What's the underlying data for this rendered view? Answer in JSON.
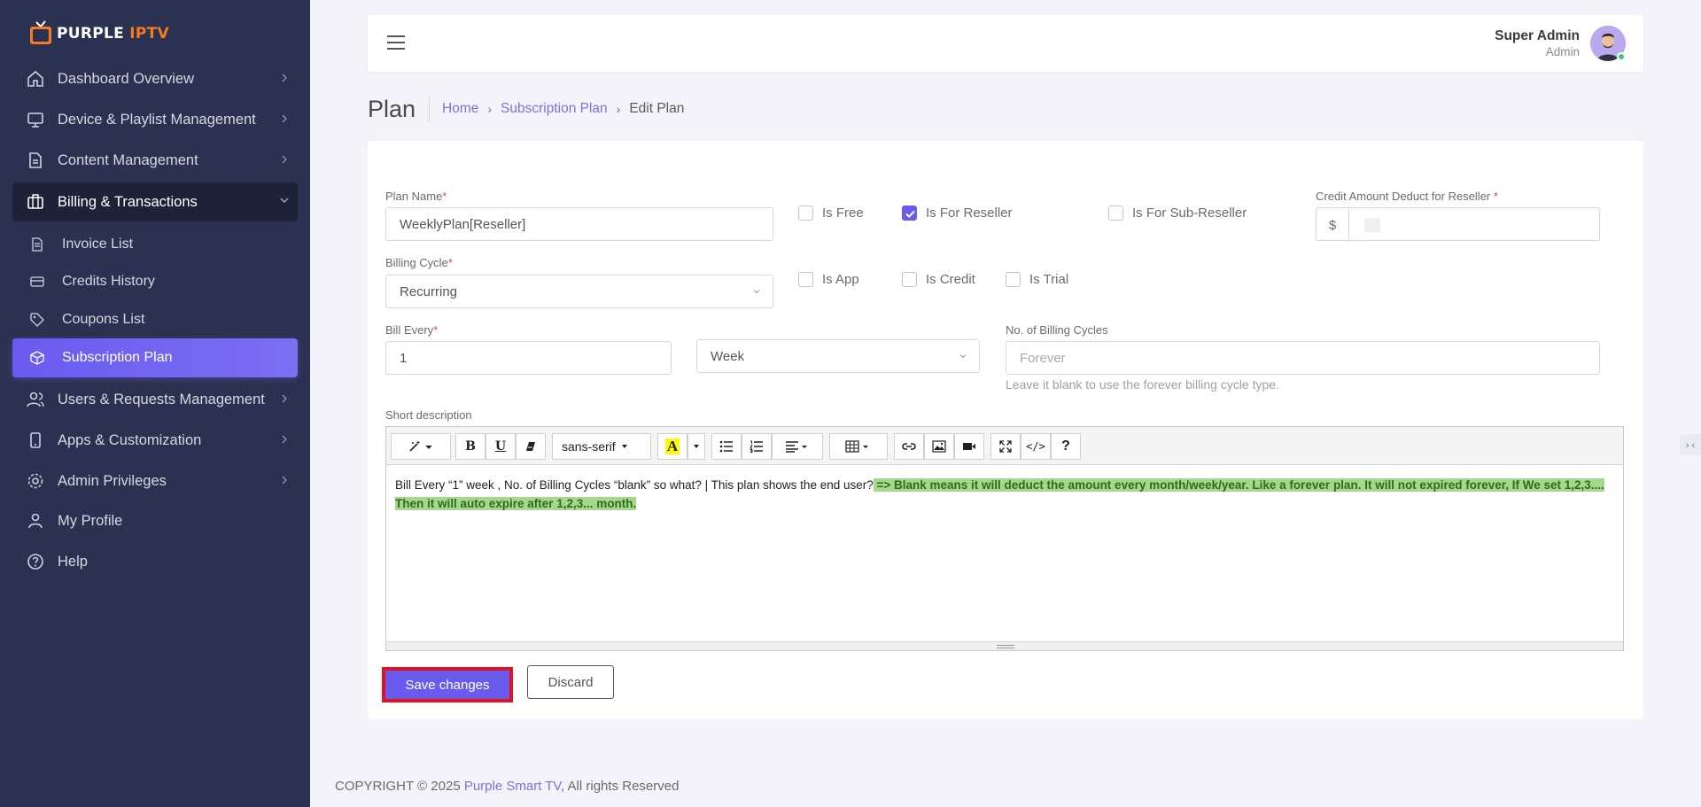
{
  "brand": {
    "word1": "PURPLE",
    "word2": "IPTV",
    "mark_text": "TV"
  },
  "sidebar": {
    "items": [
      {
        "label": "Dashboard Overview",
        "icon": "home-icon"
      },
      {
        "label": "Device & Playlist Management",
        "icon": "monitor-icon"
      },
      {
        "label": "Content Management",
        "icon": "document-icon"
      },
      {
        "label": "Billing & Transactions",
        "icon": "briefcase-icon",
        "open": true
      },
      {
        "label": "Users & Requests Management",
        "icon": "users-icon"
      },
      {
        "label": "Apps & Customization",
        "icon": "mobile-icon"
      },
      {
        "label": "Admin Privileges",
        "icon": "gear-icon"
      },
      {
        "label": "My Profile",
        "icon": "user-icon"
      },
      {
        "label": "Help",
        "icon": "help-icon"
      }
    ],
    "sub_items": [
      {
        "label": "Invoice List",
        "icon": "invoice-icon"
      },
      {
        "label": "Credits History",
        "icon": "credit-card-icon"
      },
      {
        "label": "Coupons List",
        "icon": "tag-icon"
      },
      {
        "label": "Subscription Plan",
        "icon": "cube-icon",
        "active": true
      }
    ]
  },
  "header": {
    "user_name": "Super Admin",
    "user_role": "Admin"
  },
  "page": {
    "title": "Plan",
    "breadcrumb": [
      "Home",
      "Subscription Plan",
      "Edit Plan"
    ]
  },
  "form": {
    "plan_name_label": "Plan Name",
    "plan_name_value": "WeeklyPlan[Reseller]",
    "is_free": "Is Free",
    "is_for_reseller": "Is For Reseller",
    "is_for_sub_reseller": "Is For Sub-Reseller",
    "credit_label": "Credit Amount Deduct for Reseller",
    "currency": "$",
    "billing_cycle_label": "Billing Cycle",
    "billing_cycle_value": "Recurring",
    "is_app": "Is App",
    "is_credit": "Is Credit",
    "is_trial": "Is Trial",
    "bill_every_label": "Bill Every",
    "bill_every_value": "1",
    "bill_unit_value": "Week",
    "num_cycles_label": "No. of Billing Cycles",
    "num_cycles_placeholder": "Forever",
    "num_cycles_help": "Leave it blank to use the forever billing cycle type.",
    "short_desc_label": "Short description",
    "required_mark": "*",
    "checked": {
      "is_free": false,
      "is_for_reseller": true,
      "is_for_sub_reseller": false,
      "is_app": false,
      "is_credit": false,
      "is_trial": false
    }
  },
  "editor": {
    "font_name": "sans-serif",
    "text_plain": "Bill Every “1” week , No. of Billing Cycles “blank” so what? | This plan shows the end user?",
    "text_highlight": " => Blank means it will deduct the amount every month/week/year. Like a forever plan. It will not expired forever, If We set 1,2,3.... Then it will auto expire after 1,2,3... month. ",
    "toolbar_labels": {
      "bold": "B",
      "underline": "U",
      "highlight": "A",
      "help": "?",
      "code": "</>"
    }
  },
  "actions": {
    "save": "Save changes",
    "discard": "Discard"
  },
  "footer": {
    "prefix": "COPYRIGHT © 2025 ",
    "link": "Purple Smart TV",
    "suffix": ", All rights Reserved"
  },
  "side_handle": "›‹",
  "colors": {
    "accent": "#6a5bef",
    "sidebar": "#2b3150",
    "highlight": "#a4d98b",
    "save_outline": "#e4121c"
  }
}
